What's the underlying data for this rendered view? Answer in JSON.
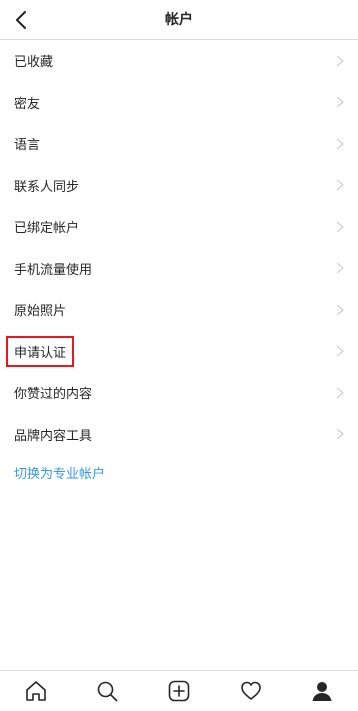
{
  "header": {
    "title": "帐户",
    "back_icon": "chevron-left-icon"
  },
  "menu": {
    "items": [
      {
        "label": "已收藏"
      },
      {
        "label": "密友"
      },
      {
        "label": "语言"
      },
      {
        "label": "联系人同步"
      },
      {
        "label": "已绑定帐户"
      },
      {
        "label": "手机流量使用"
      },
      {
        "label": "原始照片"
      },
      {
        "label": "申请认证",
        "highlighted": true
      },
      {
        "label": "你赞过的内容"
      },
      {
        "label": "品牌内容工具"
      }
    ],
    "switch_link": "切换为专业帐户"
  },
  "tabbar": {
    "tabs": [
      "home-icon",
      "search-icon",
      "add-post-icon",
      "heart-icon",
      "profile-icon"
    ]
  },
  "colors": {
    "link": "#3897f0",
    "highlight_border": "#e8161d",
    "text": "#262626",
    "divider": "#dbdbdb"
  }
}
